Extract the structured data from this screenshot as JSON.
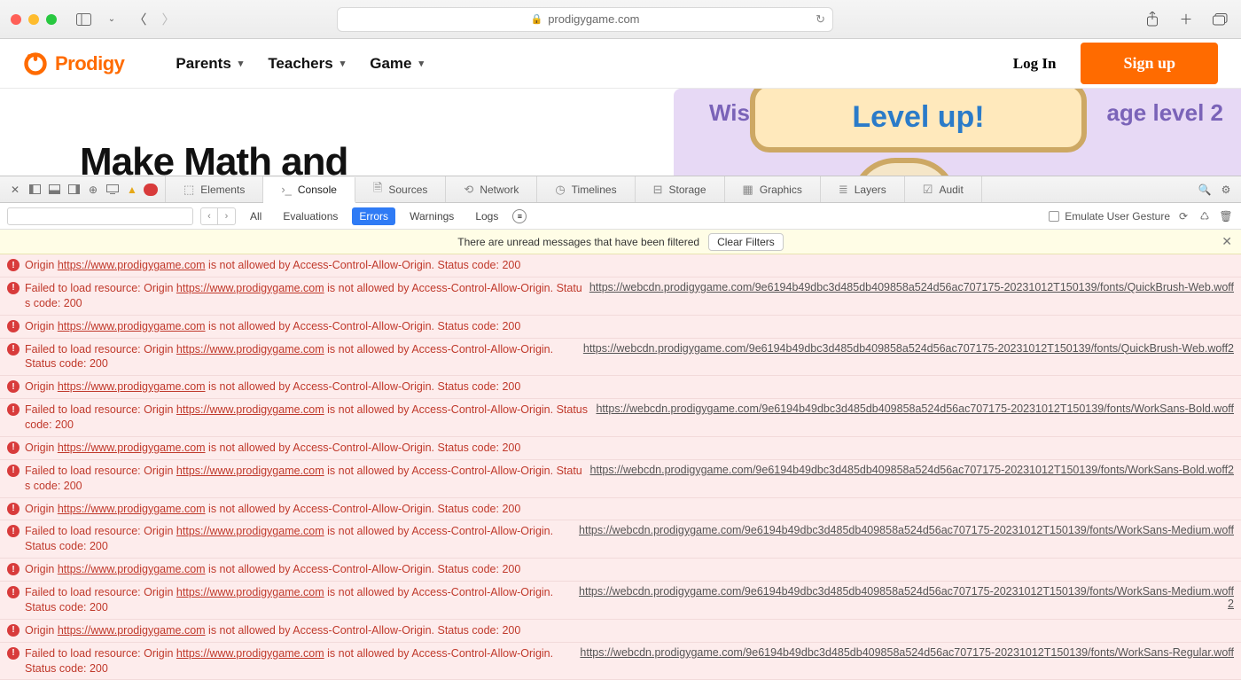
{
  "browser": {
    "domain": "prodigygame.com"
  },
  "site": {
    "brand": "Prodigy",
    "nav": [
      "Parents",
      "Teachers",
      "Game"
    ],
    "login": "Log In",
    "signup": "Sign up"
  },
  "hero": {
    "headline": "Make Math and",
    "wis": "Wis",
    "levelup": "Level up!",
    "stage": "age level 2"
  },
  "devtools": {
    "tabs": [
      "Elements",
      "Console",
      "Sources",
      "Network",
      "Timelines",
      "Storage",
      "Graphics",
      "Layers",
      "Audit"
    ],
    "activeTab": "Console",
    "errorBadge": "",
    "filters": {
      "all": "All",
      "evaluations": "Evaluations",
      "errors": "Errors",
      "warnings": "Warnings",
      "logs": "Logs",
      "active": "Errors",
      "emulate": "Emulate User Gesture"
    },
    "banner": {
      "text": "There are unread messages that have been filtered",
      "button": "Clear Filters"
    }
  },
  "console": {
    "originUrl": "https://www.prodigygame.com",
    "originPrefix": "Origin ",
    "originSuffix": " is not allowed by Access-Control-Allow-Origin. Status code: 200",
    "failedPrefix": "Failed to load resource: Origin ",
    "failedSuffixInline": " is not allowed by Access-Control-Allow-Origin. Status code: 200",
    "failedSuffixWrap": " is not allowed by Access-Control-Allow-Origin. Status code: 200",
    "rows": [
      {
        "type": "origin"
      },
      {
        "type": "failed",
        "wrap": "inline",
        "res": "https://webcdn.prodigygame.com/9e6194b49dbc3d485db409858a524d56ac707175-20231012T150139/fonts/QuickBrush-Web.woff"
      },
      {
        "type": "origin"
      },
      {
        "type": "failed",
        "wrap": "wrap",
        "res": "https://webcdn.prodigygame.com/9e6194b49dbc3d485db409858a524d56ac707175-20231012T150139/fonts/QuickBrush-Web.woff2"
      },
      {
        "type": "origin"
      },
      {
        "type": "failed",
        "wrap": "inline",
        "res": "https://webcdn.prodigygame.com/9e6194b49dbc3d485db409858a524d56ac707175-20231012T150139/fonts/WorkSans-Bold.woff"
      },
      {
        "type": "origin"
      },
      {
        "type": "failed",
        "wrap": "inline",
        "res": "https://webcdn.prodigygame.com/9e6194b49dbc3d485db409858a524d56ac707175-20231012T150139/fonts/WorkSans-Bold.woff2"
      },
      {
        "type": "origin"
      },
      {
        "type": "failed",
        "wrap": "wrap",
        "res": "https://webcdn.prodigygame.com/9e6194b49dbc3d485db409858a524d56ac707175-20231012T150139/fonts/WorkSans-Medium.woff"
      },
      {
        "type": "origin"
      },
      {
        "type": "failed",
        "wrap": "wrap",
        "res": "https://webcdn.prodigygame.com/9e6194b49dbc3d485db409858a524d56ac707175-20231012T150139/fonts/WorkSans-Medium.woff2"
      },
      {
        "type": "origin"
      },
      {
        "type": "failed",
        "wrap": "wrap",
        "res": "https://webcdn.prodigygame.com/9e6194b49dbc3d485db409858a524d56ac707175-20231012T150139/fonts/WorkSans-Regular.woff"
      }
    ]
  }
}
